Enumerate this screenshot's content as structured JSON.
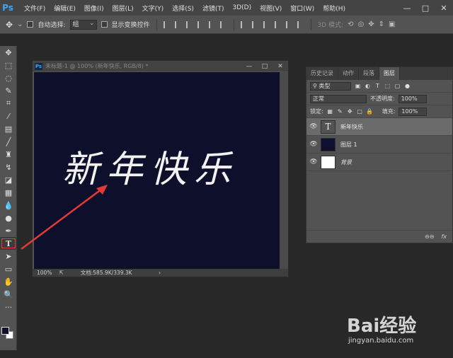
{
  "app": {
    "logo": "Ps"
  },
  "menu": [
    "文件(F)",
    "编辑(E)",
    "图像(I)",
    "图层(L)",
    "文字(Y)",
    "选择(S)",
    "滤镜(T)",
    "3D(D)",
    "视图(V)",
    "窗口(W)",
    "帮助(H)"
  ],
  "window_controls": [
    "—",
    "□",
    "✕"
  ],
  "options_bar": {
    "auto_select_label": "自动选择:",
    "auto_select_value": "组",
    "show_transform_label": "显示变换控件",
    "mode_3d_label": "3D 模式:"
  },
  "tools": [
    "move-tool",
    "marquee-tool",
    "lasso-tool",
    "quick-select-tool",
    "crop-tool",
    "eyedropper-tool",
    "healing-tool",
    "brush-tool",
    "stamp-tool",
    "history-brush-tool",
    "eraser-tool",
    "gradient-tool",
    "blur-tool",
    "dodge-tool",
    "pen-tool",
    "type-tool",
    "path-select-tool",
    "shape-tool",
    "hand-tool",
    "zoom-tool",
    "more-tool"
  ],
  "active_tool": "type-tool",
  "colors": {
    "foreground": "#101030",
    "background": "#ffffff",
    "annotation": "#e53935",
    "canvas": "#0e0f2b"
  },
  "document": {
    "title": "未标题-1 @ 100% (新年快乐, RGB/8) *",
    "canvas_text": "新年快乐",
    "zoom": "100%",
    "doc_info": "文档:585.9K/339.3K"
  },
  "layers_panel": {
    "tabs": [
      "历史记录",
      "动作",
      "段落",
      "图层"
    ],
    "active_tab": "图层",
    "filter_label": "类型",
    "blend_mode": "正常",
    "opacity_label": "不透明度:",
    "opacity_value": "100%",
    "lock_label": "锁定:",
    "fill_label": "填充:",
    "fill_value": "100%",
    "layers": [
      {
        "name": "新年快乐",
        "thumb": "T",
        "selected": true
      },
      {
        "name": "图层 1",
        "thumb": "",
        "selected": false
      },
      {
        "name": "背景",
        "thumb": "",
        "selected": false
      }
    ],
    "footer_icons": [
      "link-icon",
      "fx-icon"
    ],
    "footer_fx": "fx"
  },
  "watermark": {
    "brand": "Bai经验",
    "url": "jingyan.baidu.com"
  }
}
